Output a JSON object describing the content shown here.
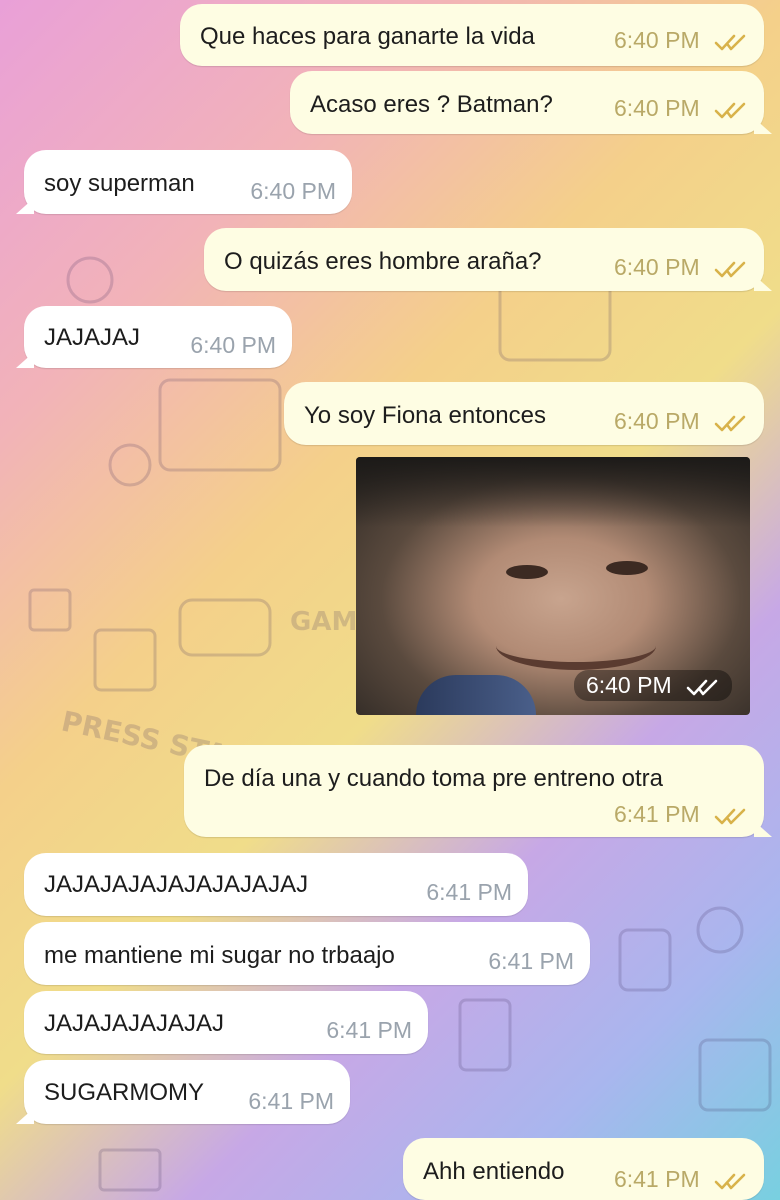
{
  "colors": {
    "outgoing_bubble": "#fefde3",
    "incoming_bubble": "#ffffff",
    "read_ticks": "#d8b24a",
    "photo_ticks": "#ffffff"
  },
  "background": {
    "pattern_icons": [
      "gamepad-icon",
      "ghost-icon",
      "dice-icon",
      "joystick-icon",
      "floppy-disk-icon",
      "phone-icon"
    ],
    "pattern_text": [
      "GAME OVER",
      "PRESS START"
    ]
  },
  "messages": [
    {
      "dir": "out",
      "text": "Que haces para ganarte la vida",
      "time": "6:40 PM",
      "status": "read-icon"
    },
    {
      "dir": "out",
      "text": "Acaso eres ? Batman?",
      "time": "6:40 PM",
      "status": "read-icon"
    },
    {
      "dir": "in",
      "text": "soy superman",
      "time": "6:40 PM"
    },
    {
      "dir": "out",
      "text": "O quizás eres hombre araña?",
      "time": "6:40 PM",
      "status": "read-icon"
    },
    {
      "dir": "in",
      "text": "JAJAJAJ",
      "time": "6:40 PM"
    },
    {
      "dir": "out",
      "text": "Yo soy Fiona entonces",
      "time": "6:40 PM",
      "status": "read-icon"
    },
    {
      "dir": "out",
      "type": "photo",
      "time": "6:40 PM",
      "status": "read-icon"
    },
    {
      "dir": "out",
      "text": "De día una y cuando toma pre entreno otra",
      "time": "6:41 PM",
      "status": "read-icon"
    },
    {
      "dir": "in",
      "text": "JAJAJAJAJAJAJAJAJAJ",
      "time": "6:41 PM"
    },
    {
      "dir": "in",
      "text": "me mantiene mi sugar no trbaajo",
      "time": "6:41 PM"
    },
    {
      "dir": "in",
      "text": "JAJAJAJAJAJAJ",
      "time": "6:41 PM"
    },
    {
      "dir": "in",
      "text": "SUGARMOMY",
      "time": "6:41 PM"
    },
    {
      "dir": "out",
      "text": "Ahh entiendo",
      "time": "6:41 PM",
      "status": "read-icon"
    }
  ]
}
